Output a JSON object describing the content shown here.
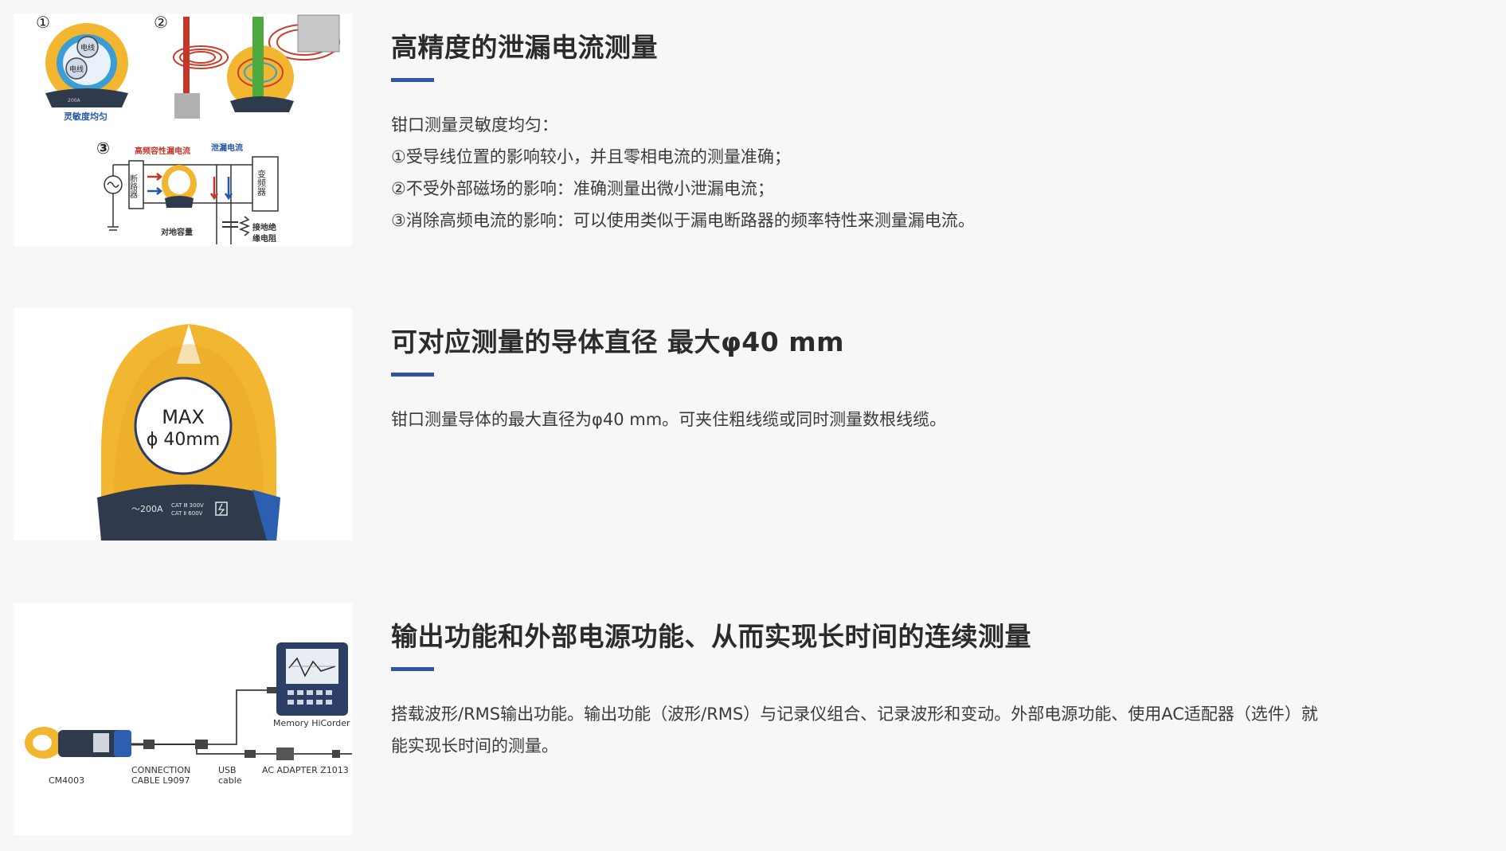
{
  "colors": {
    "background": "#f7f7f7",
    "accent": "#2f55a4",
    "heading": "#2b2b2b",
    "body_text": "#3a3a3a",
    "clamp_yellow": "#f2b630",
    "meter_dark": "#2f3a4d"
  },
  "features": [
    {
      "title": "高精度的泄漏电流测量",
      "image": {
        "labels": {
          "marker_1": "①",
          "marker_2": "②",
          "marker_3": "③",
          "wire_a": "电线",
          "wire_b": "电线",
          "caption": "灵敏度均匀",
          "hf_leak": "高频容性漏电流",
          "leak": "泄漏电流",
          "breaker": "断路器",
          "inverter": "变频器",
          "ground_cap": "对地容量",
          "ground_res_1": "接地绝",
          "ground_res_2": "缘电阻",
          "meter_small": "200A"
        }
      },
      "lines": [
        "钳口测量灵敏度均匀：",
        "①受导线位置的影响较小，并且零相电流的测量准确；",
        "②不受外部磁场的影响：准确测量出微小泄漏电流；",
        "③消除高频电流的影响：可以使用类似于漏电断路器的频率特性来测量漏电流。"
      ]
    },
    {
      "title": "可对应测量的导体直径 最大φ40 mm",
      "image": {
        "labels": {
          "max": "MAX",
          "diameter": "ϕ 40mm",
          "range": "～200A",
          "cat_1": "CAT Ⅲ 300V",
          "cat_2": "CAT Ⅱ 600V"
        }
      },
      "lines": [
        "钳口测量导体的最大直径为φ40 mm。可夹住粗线缆或同时测量数根线缆。"
      ]
    },
    {
      "title": "输出功能和外部电源功能、从而实现长时间的连续测量",
      "image": {
        "labels": {
          "device": "CM4003",
          "cable_1": "CONNECTION",
          "cable_2": "CABLE L9097",
          "usb_1": "USB",
          "usb_2": "cable",
          "adapter": "AC ADAPTER Z1013",
          "recorder": "Memory HiCorder"
        }
      },
      "lines": [
        "搭载波形/RMS输出功能。输出功能（波形/RMS）与记录仪组合、记录波形和变动。外部电源功能、使用AC适配器（选件）就能实现长时间的测量。"
      ]
    }
  ]
}
